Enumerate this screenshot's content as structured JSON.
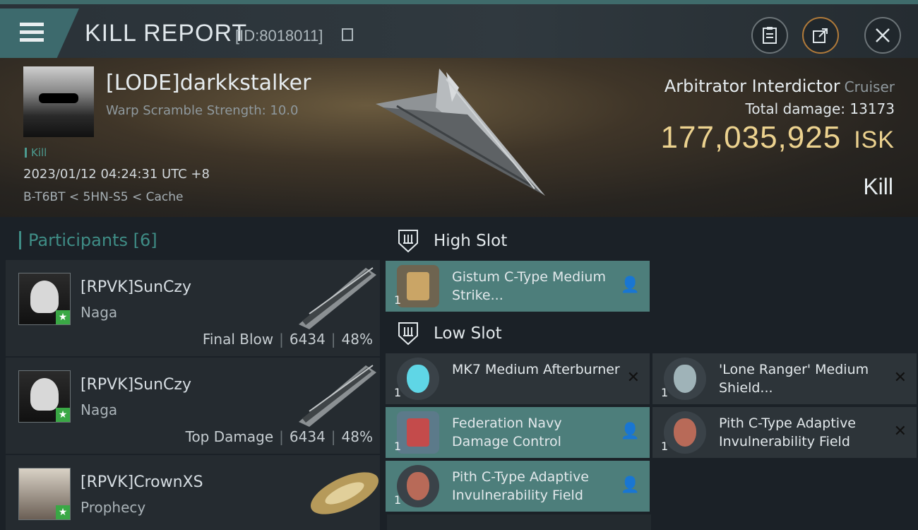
{
  "header": {
    "title": "KILL REPORT",
    "kill_id": "[ID:8018011]"
  },
  "victim": {
    "name": "[LODE]darkkstalker",
    "warp_scramble": "Warp Scramble Strength: 10.0",
    "tag": "Kill",
    "datetime": "2023/01/12 04:24:31 UTC +8",
    "location": "B-T6BT < 5HN-S5 < Cache",
    "ship_name": "Arbitrator Interdictor",
    "ship_class": "Cruiser",
    "total_damage_label": "Total damage:",
    "total_damage": "13173",
    "isk_value": "177,035,925",
    "isk_unit": "ISK",
    "result": "Kill"
  },
  "participants": {
    "title": "Participants [6]",
    "rows": [
      {
        "name": "[RPVK]SunCzy",
        "ship": "Naga",
        "role": "Final Blow",
        "damage": "6434",
        "percent": "48%"
      },
      {
        "name": "[RPVK]SunCzy",
        "ship": "Naga",
        "role": "Top Damage",
        "damage": "6434",
        "percent": "48%"
      },
      {
        "name": "[RPVK]CrownXS",
        "ship": "Prophecy",
        "role": "",
        "damage": "",
        "percent": ""
      }
    ]
  },
  "slots": {
    "high_label": "High Slot",
    "low_label": "Low Slot",
    "high": [
      {
        "name": "Gistum C-Type Medium Strike...",
        "qty": "1",
        "state": "dropped"
      }
    ],
    "low": [
      {
        "name": "MK7 Medium Afterburner",
        "qty": "1",
        "state": "destroyed"
      },
      {
        "name": "'Lone Ranger' Medium Shield...",
        "qty": "1",
        "state": "destroyed"
      },
      {
        "name": "Federation Navy Damage Control",
        "qty": "1",
        "state": "dropped"
      },
      {
        "name": "Pith C-Type Adaptive Invulnerability Field",
        "qty": "1",
        "state": "destroyed"
      },
      {
        "name": "Pith C-Type Adaptive Invulnerability Field",
        "qty": "1",
        "state": "dropped"
      }
    ]
  },
  "icons": {
    "menu": "menu-icon",
    "clipboard": "clipboard-icon",
    "share": "share-icon",
    "close": "close-icon",
    "slot": "slot-shield-icon",
    "pilot": "pilot-icon",
    "destroyed": "destroyed-x-icon"
  },
  "colors": {
    "accent_teal": "#4d7e7b",
    "isk_gold": "#ecd28f",
    "star_green": "#3aa845"
  }
}
